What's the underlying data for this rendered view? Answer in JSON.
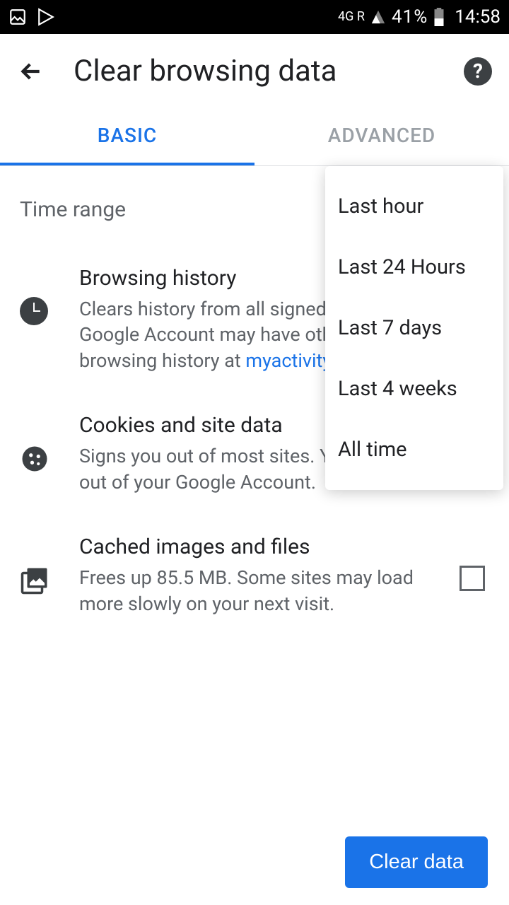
{
  "status_bar": {
    "network": "4G R",
    "battery_pct": "41%",
    "time": "14:58"
  },
  "header": {
    "title": "Clear browsing data"
  },
  "tabs": {
    "basic": "BASIC",
    "advanced": "ADVANCED"
  },
  "time_range_label": "Time range",
  "dropdown": {
    "options": [
      "Last hour",
      "Last 24 Hours",
      "Last 7 days",
      "Last 4 weeks",
      "All time"
    ]
  },
  "items": {
    "history": {
      "title": "Browsing history",
      "desc_pre": "Clears history from all signed-in devices. Your Google Account may have other forms of browsing history at ",
      "desc_link": "myactivity.google.com"
    },
    "cookies": {
      "title": "Cookies and site data",
      "desc": "Signs you out of most sites. You won't be signed out of your Google Account."
    },
    "cache": {
      "title": "Cached images and files",
      "desc": "Frees up 85.5 MB. Some sites may load more slowly on your next visit."
    }
  },
  "footer": {
    "clear": "Clear data"
  }
}
